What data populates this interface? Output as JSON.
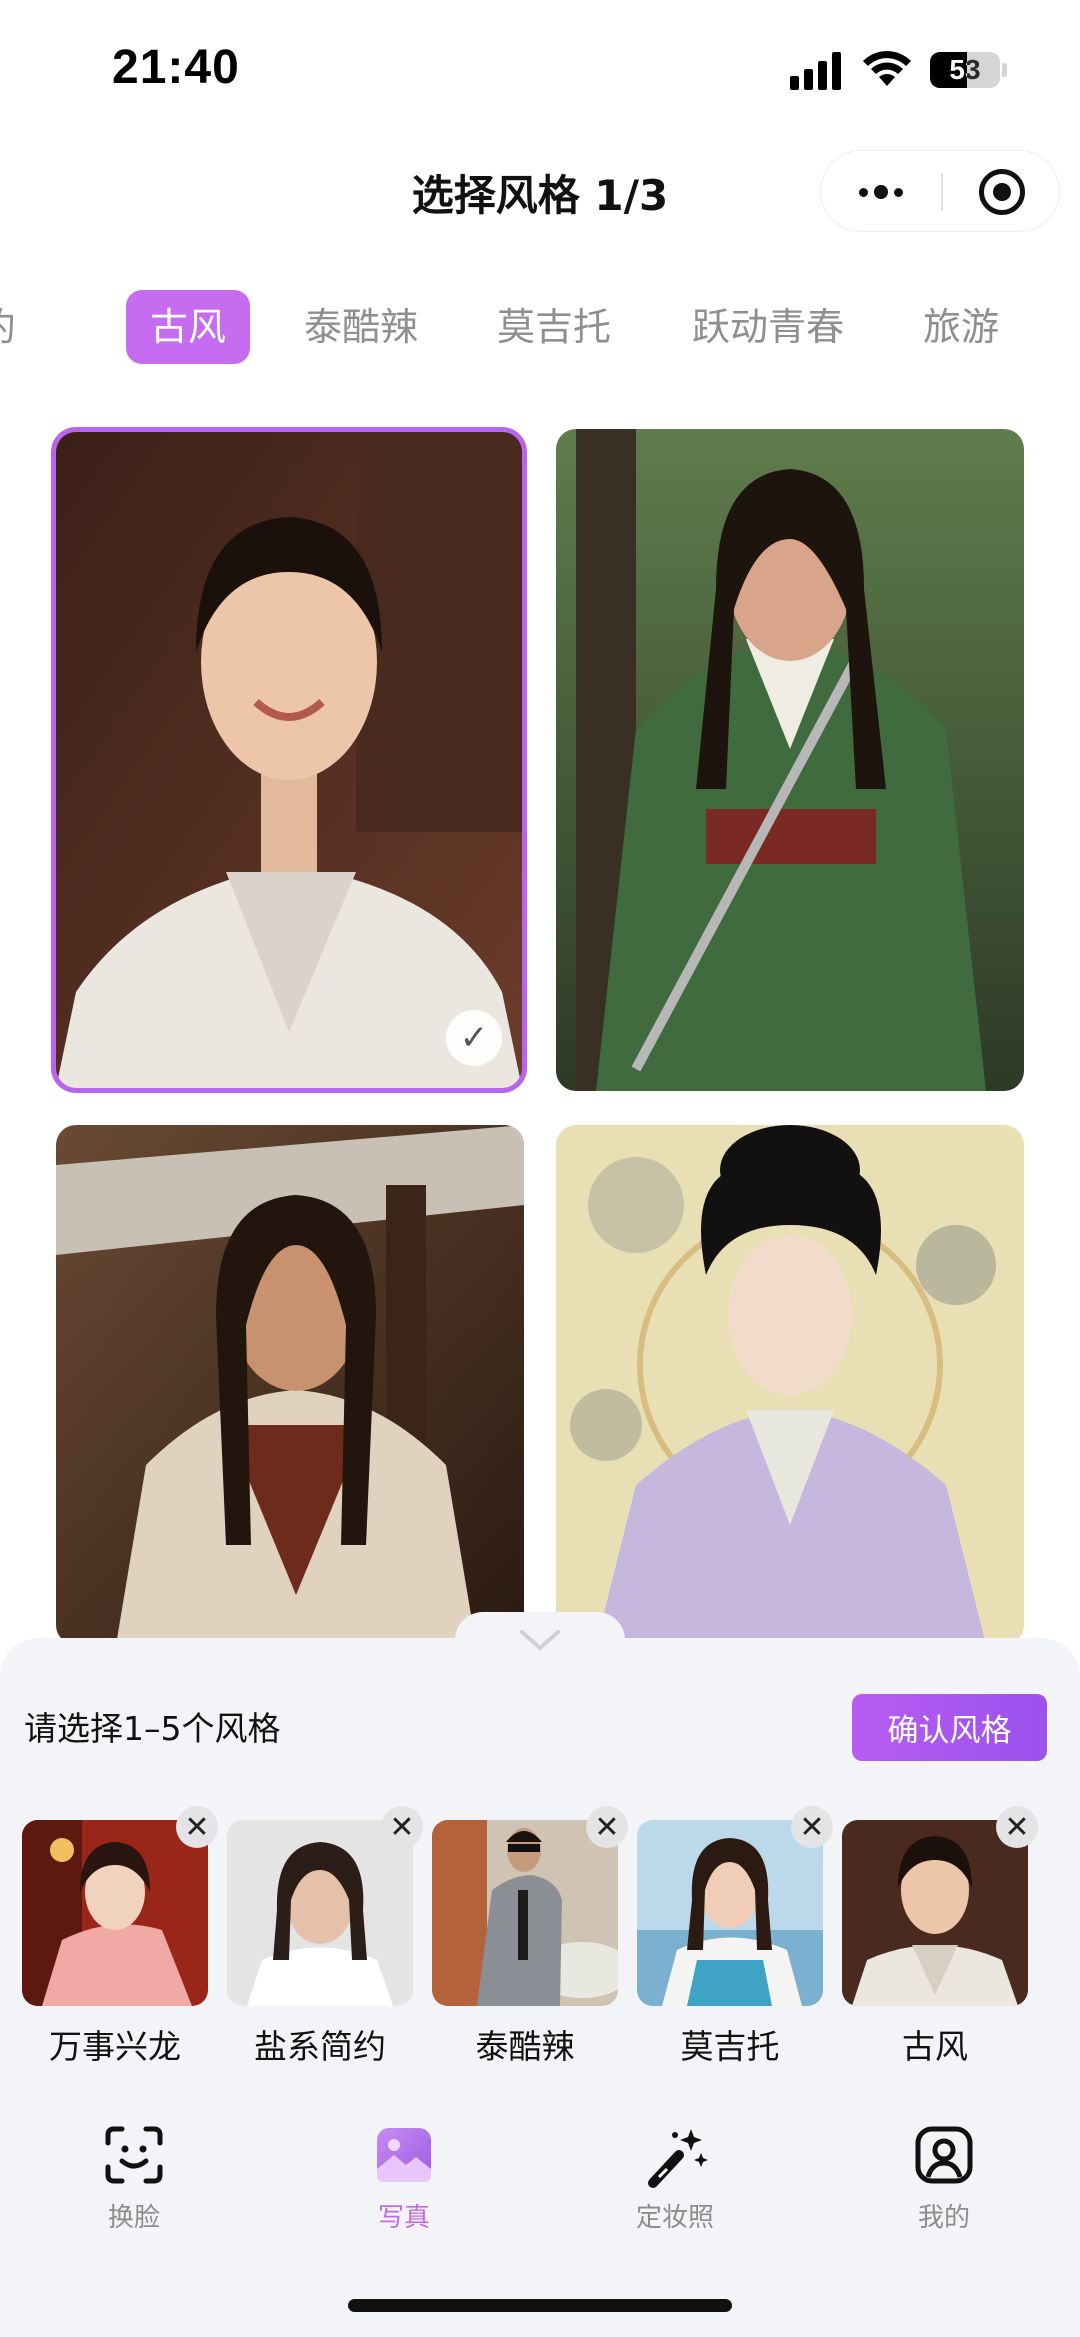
{
  "status_bar": {
    "time": "21:40",
    "battery": "53",
    "battery_level": 0.53
  },
  "header": {
    "title": "选择风格 1/3"
  },
  "tabs": [
    {
      "label": "约",
      "active": false
    },
    {
      "label": "古风",
      "active": true
    },
    {
      "label": "泰酷辣",
      "active": false
    },
    {
      "label": "莫吉托",
      "active": false
    },
    {
      "label": "跃动青春",
      "active": false
    },
    {
      "label": "旅游",
      "active": false
    }
  ],
  "styles_grid": [
    {
      "selected": true
    },
    {
      "selected": false
    },
    {
      "selected": false
    },
    {
      "selected": false
    }
  ],
  "sheet": {
    "hint": "请选择1–5个风格",
    "confirm_label": "确认风格",
    "selected": [
      {
        "label": "万事兴龙"
      },
      {
        "label": "盐系简约"
      },
      {
        "label": "泰酷辣"
      },
      {
        "label": "莫吉托"
      },
      {
        "label": "古风"
      }
    ]
  },
  "tabbar": [
    {
      "label": "换脸",
      "icon": "face-swap-icon",
      "active": false
    },
    {
      "label": "写真",
      "icon": "photo-icon",
      "active": true
    },
    {
      "label": "定妆照",
      "icon": "magic-wand-icon",
      "active": false
    },
    {
      "label": "我的",
      "icon": "profile-icon",
      "active": false
    }
  ],
  "colors": {
    "accent": "#c56cf0",
    "sheet_bg": "#f3f4f7",
    "inactive": "#8f8f8f"
  }
}
